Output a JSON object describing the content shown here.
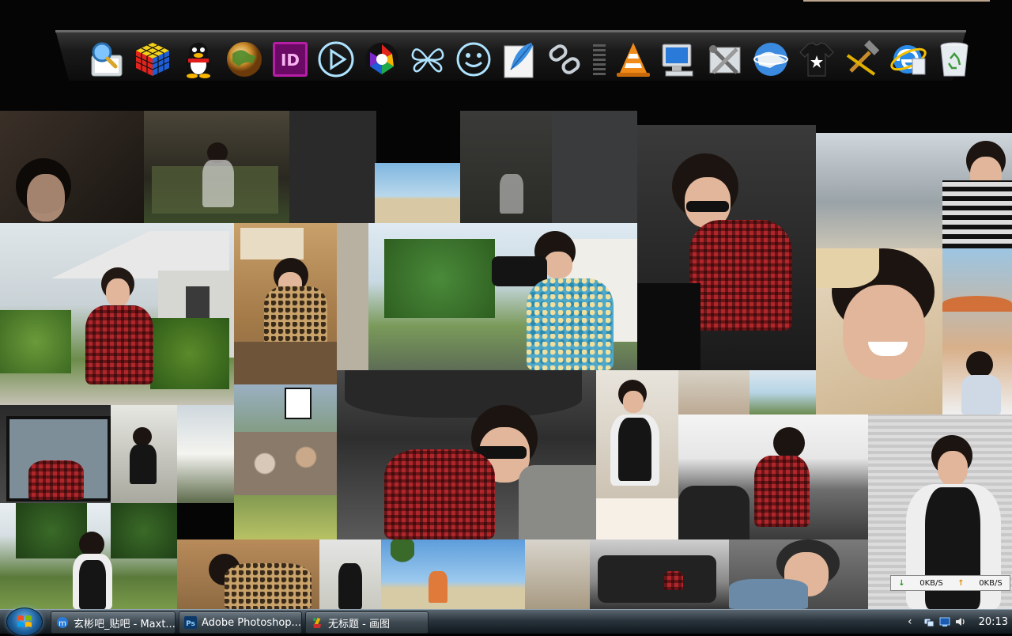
{
  "desktop": {
    "dock_items": [
      {
        "name": "search-icon"
      },
      {
        "name": "rubiks-cube-icon"
      },
      {
        "name": "qq-penguin-icon"
      },
      {
        "name": "globe-browser-icon"
      },
      {
        "name": "indesign-icon",
        "text": "ID"
      },
      {
        "name": "media-play-icon"
      },
      {
        "name": "picasa-icon"
      },
      {
        "name": "butterfly-icon"
      },
      {
        "name": "smiley-icon"
      },
      {
        "name": "feather-document-icon"
      },
      {
        "name": "chain-link-icon"
      },
      {
        "name": "volume-bar-icon"
      },
      {
        "name": "vlc-cone-icon"
      },
      {
        "name": "my-computer-icon"
      },
      {
        "name": "system-tools-icon"
      },
      {
        "name": "network-globe-icon"
      },
      {
        "name": "tshirt-icon"
      },
      {
        "name": "hammer-tools-icon"
      },
      {
        "name": "internet-explorer-icon"
      },
      {
        "name": "recycle-bin-icon"
      }
    ],
    "netspeed": {
      "download": "0KB/S",
      "upload": "0KB/S"
    }
  },
  "taskbar": {
    "start_icon": "windows-logo-icon",
    "tasks": [
      {
        "label": "玄彬吧_贴吧 - Maxt...",
        "icon": "maxthon-browser-icon"
      },
      {
        "label": "Adobe Photoshop...",
        "icon": "photoshop-icon",
        "icon_text": "Ps"
      },
      {
        "label": "无标题 - 画图",
        "icon": "paint-icon"
      }
    ],
    "tray_chevron": "‹",
    "clock": "20:13"
  },
  "colors": {
    "taskbar_top": "#5a6670",
    "taskbar_bottom": "#10171d",
    "dock_bg": "#1a1a1a",
    "download_arrow": "#1a9a1a",
    "upload_arrow": "#e08a00"
  }
}
